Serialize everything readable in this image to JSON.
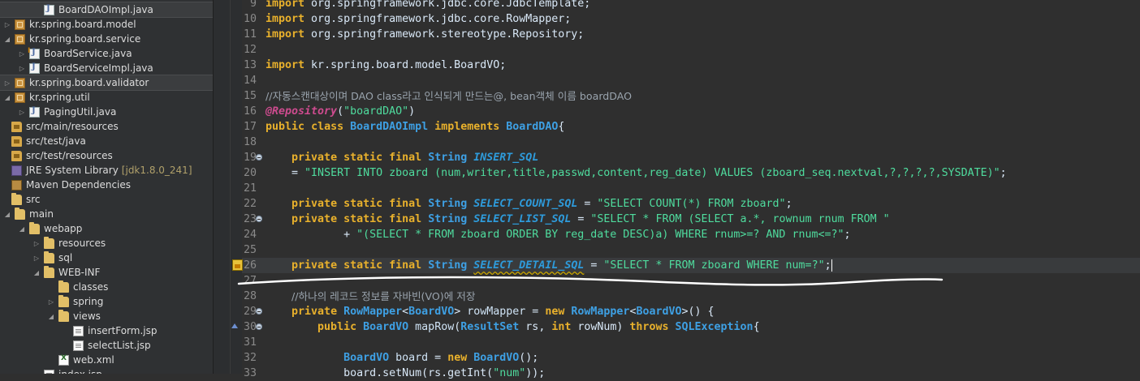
{
  "explorer": {
    "items": [
      {
        "label": "BoardDAOImpl.java",
        "icon": "java-class-icon",
        "twisty": "",
        "indent": 40
      },
      {
        "label": "kr.spring.board.model",
        "icon": "package-icon",
        "twisty": "▷",
        "indent": 4
      },
      {
        "label": "kr.spring.board.service",
        "icon": "package-icon",
        "twisty": "◢",
        "indent": 4
      },
      {
        "label": "BoardService.java",
        "icon": "java-interface-icon",
        "twisty": "▷",
        "indent": 22
      },
      {
        "label": "BoardServiceImpl.java",
        "icon": "java-class-icon",
        "twisty": "▷",
        "indent": 22
      },
      {
        "label": "kr.spring.board.validator",
        "icon": "package-icon",
        "twisty": "▷",
        "indent": 4
      },
      {
        "label": "kr.spring.util",
        "icon": "package-icon",
        "twisty": "◢",
        "indent": 4
      },
      {
        "label": "PagingUtil.java",
        "icon": "java-class-icon",
        "twisty": "▷",
        "indent": 22
      },
      {
        "label": "src/main/resources",
        "icon": "source-folder-icon",
        "twisty": "",
        "indent": 0
      },
      {
        "label": "src/test/java",
        "icon": "source-folder-icon",
        "twisty": "",
        "indent": 0
      },
      {
        "label": "src/test/resources",
        "icon": "source-folder-icon",
        "twisty": "",
        "indent": 0
      },
      {
        "label": "JRE System Library",
        "suffix": "[jdk1.8.0_241]",
        "icon": "library-icon",
        "twisty": "",
        "indent": 0
      },
      {
        "label": "Maven Dependencies",
        "icon": "jar-library-icon",
        "twisty": "",
        "indent": 0
      },
      {
        "label": "src",
        "icon": "folder-icon",
        "twisty": "",
        "indent": 0
      },
      {
        "label": "main",
        "icon": "folder-icon",
        "twisty": "◢",
        "indent": 4
      },
      {
        "label": "webapp",
        "icon": "folder-icon",
        "twisty": "◢",
        "indent": 22
      },
      {
        "label": "resources",
        "icon": "folder-icon",
        "twisty": "▷",
        "indent": 40
      },
      {
        "label": "sql",
        "icon": "folder-icon",
        "twisty": "▷",
        "indent": 40
      },
      {
        "label": "WEB-INF",
        "icon": "folder-icon",
        "twisty": "◢",
        "indent": 40
      },
      {
        "label": "classes",
        "icon": "folder-icon",
        "twisty": "",
        "indent": 58
      },
      {
        "label": "spring",
        "icon": "folder-icon",
        "twisty": "▷",
        "indent": 58
      },
      {
        "label": "views",
        "icon": "folder-icon",
        "twisty": "◢",
        "indent": 58
      },
      {
        "label": "insertForm.jsp",
        "icon": "file-icon",
        "twisty": "",
        "indent": 76
      },
      {
        "label": "selectList.jsp",
        "icon": "file-icon",
        "twisty": "",
        "indent": 76
      },
      {
        "label": "web.xml",
        "icon": "xml-file-icon",
        "twisty": "",
        "indent": 58
      },
      {
        "label": "index.jsp",
        "icon": "file-icon",
        "twisty": "",
        "indent": 40
      }
    ]
  },
  "editor": {
    "lines": [
      {
        "n": "9",
        "html": [
          [
            "kw",
            "import"
          ],
          [
            "plain",
            " org.springframework.jdbc.core.JdbcTemplate;"
          ]
        ]
      },
      {
        "n": "10",
        "html": [
          [
            "kw",
            "import"
          ],
          [
            "plain",
            " org.springframework.jdbc.core.RowMapper;"
          ]
        ]
      },
      {
        "n": "11",
        "html": [
          [
            "kw",
            "import"
          ],
          [
            "plain",
            " org.springframework.stereotype.Repository;"
          ]
        ]
      },
      {
        "n": "12",
        "html": []
      },
      {
        "n": "13",
        "html": [
          [
            "kw",
            "import"
          ],
          [
            "plain",
            " kr.spring.board.model.BoardVO;"
          ]
        ]
      },
      {
        "n": "14",
        "html": []
      },
      {
        "n": "15",
        "html": [
          [
            "cm",
            "//자동스캔대상이며 DAO class라고 인식되게 만드는@, bean객체 이름 boardDAO"
          ]
        ]
      },
      {
        "n": "16",
        "html": [
          [
            "ann",
            "@Repository"
          ],
          [
            "plain",
            "("
          ],
          [
            "st",
            "\"boardDAO\""
          ],
          [
            "plain",
            ")"
          ]
        ]
      },
      {
        "n": "17",
        "html": [
          [
            "kw",
            "public"
          ],
          [
            "plain",
            " "
          ],
          [
            "kw",
            "class"
          ],
          [
            "plain",
            " "
          ],
          [
            "ty",
            "BoardDAOImpl"
          ],
          [
            "plain",
            " "
          ],
          [
            "kw",
            "implements"
          ],
          [
            "plain",
            " "
          ],
          [
            "ty",
            "BoardDAO"
          ],
          [
            "plain",
            "{"
          ]
        ]
      },
      {
        "n": "18",
        "html": []
      },
      {
        "n": "19",
        "fold": true,
        "html": [
          [
            "plain",
            "    "
          ],
          [
            "kw",
            "private"
          ],
          [
            "plain",
            " "
          ],
          [
            "kw",
            "static"
          ],
          [
            "plain",
            " "
          ],
          [
            "kw",
            "final"
          ],
          [
            "plain",
            " "
          ],
          [
            "ty",
            "String"
          ],
          [
            "plain",
            " "
          ],
          [
            "cs",
            "INSERT_SQL"
          ]
        ]
      },
      {
        "n": "20",
        "html": [
          [
            "plain",
            "    = "
          ],
          [
            "st",
            "\"INSERT INTO zboard (num,writer,title,passwd,content,reg_date) VALUES (zboard_seq.nextval,?,?,?,?,SYSDATE)\""
          ],
          [
            "plain",
            ";"
          ]
        ]
      },
      {
        "n": "21",
        "html": []
      },
      {
        "n": "22",
        "html": [
          [
            "plain",
            "    "
          ],
          [
            "kw",
            "private"
          ],
          [
            "plain",
            " "
          ],
          [
            "kw",
            "static"
          ],
          [
            "plain",
            " "
          ],
          [
            "kw",
            "final"
          ],
          [
            "plain",
            " "
          ],
          [
            "ty",
            "String"
          ],
          [
            "plain",
            " "
          ],
          [
            "cs",
            "SELECT_COUNT_SQL"
          ],
          [
            "plain",
            " = "
          ],
          [
            "st",
            "\"SELECT COUNT(*) FROM zboard\""
          ],
          [
            "plain",
            ";"
          ]
        ]
      },
      {
        "n": "23",
        "fold": true,
        "html": [
          [
            "plain",
            "    "
          ],
          [
            "kw",
            "private"
          ],
          [
            "plain",
            " "
          ],
          [
            "kw",
            "static"
          ],
          [
            "plain",
            " "
          ],
          [
            "kw",
            "final"
          ],
          [
            "plain",
            " "
          ],
          [
            "ty",
            "String"
          ],
          [
            "plain",
            " "
          ],
          [
            "cs",
            "SELECT_LIST_SQL"
          ],
          [
            "plain",
            " = "
          ],
          [
            "st",
            "\"SELECT * FROM (SELECT a.*, rownum rnum FROM \""
          ]
        ]
      },
      {
        "n": "24",
        "html": [
          [
            "plain",
            "            + "
          ],
          [
            "st",
            "\"(SELECT * FROM zboard ORDER BY reg_date DESC)a) WHERE rnum>=? AND rnum<=?\""
          ],
          [
            "plain",
            ";"
          ]
        ]
      },
      {
        "n": "25",
        "html": []
      },
      {
        "n": "26",
        "current": true,
        "warning": true,
        "html": [
          [
            "plain",
            "    "
          ],
          [
            "kw",
            "private"
          ],
          [
            "plain",
            " "
          ],
          [
            "kw",
            "static"
          ],
          [
            "plain",
            " "
          ],
          [
            "kw",
            "final"
          ],
          [
            "plain",
            " "
          ],
          [
            "ty",
            "String"
          ],
          [
            "plain",
            " "
          ],
          [
            "cs squiggle",
            "SELECT_DETAIL_SQL"
          ],
          [
            "plain",
            " = "
          ],
          [
            "st",
            "\"SELECT * FROM zboard WHERE num=?\""
          ],
          [
            "plain",
            ";"
          ]
        ]
      },
      {
        "n": "27",
        "html": []
      },
      {
        "n": "28",
        "html": [
          [
            "plain",
            "    "
          ],
          [
            "cm",
            "//하나의 레코드 정보를 자바빈(VO)에 저장"
          ]
        ]
      },
      {
        "n": "29",
        "fold": true,
        "html": [
          [
            "plain",
            "    "
          ],
          [
            "kw",
            "private"
          ],
          [
            "plain",
            " "
          ],
          [
            "ty",
            "RowMapper"
          ],
          [
            "plain",
            "<"
          ],
          [
            "ty",
            "BoardVO"
          ],
          [
            "plain",
            "> "
          ],
          [
            "fn",
            "rowMapper"
          ],
          [
            "plain",
            " = "
          ],
          [
            "kw",
            "new"
          ],
          [
            "plain",
            " "
          ],
          [
            "ty",
            "RowMapper"
          ],
          [
            "plain",
            "<"
          ],
          [
            "ty",
            "BoardVO"
          ],
          [
            "plain",
            ">() {"
          ]
        ]
      },
      {
        "n": "30",
        "fold": true,
        "override": true,
        "html": [
          [
            "plain",
            "        "
          ],
          [
            "kw",
            "public"
          ],
          [
            "plain",
            " "
          ],
          [
            "ty",
            "BoardVO"
          ],
          [
            "plain",
            " "
          ],
          [
            "fn",
            "mapRow"
          ],
          [
            "plain",
            "("
          ],
          [
            "ty",
            "ResultSet"
          ],
          [
            "plain",
            " rs, "
          ],
          [
            "kw",
            "int"
          ],
          [
            "plain",
            " rowNum) "
          ],
          [
            "kw",
            "throws"
          ],
          [
            "plain",
            " "
          ],
          [
            "ty",
            "SQLException"
          ],
          [
            "plain",
            "{"
          ]
        ]
      },
      {
        "n": "31",
        "html": []
      },
      {
        "n": "32",
        "html": [
          [
            "plain",
            "            "
          ],
          [
            "ty",
            "BoardVO"
          ],
          [
            "plain",
            " "
          ],
          [
            "fn",
            "board"
          ],
          [
            "plain",
            " = "
          ],
          [
            "kw",
            "new"
          ],
          [
            "plain",
            " "
          ],
          [
            "ty",
            "BoardVO"
          ],
          [
            "plain",
            "();"
          ]
        ]
      },
      {
        "n": "33",
        "html": [
          [
            "plain",
            "            board.setNum(rs.getInt("
          ],
          [
            "st",
            "\"num\""
          ],
          [
            "plain",
            "));"
          ]
        ]
      }
    ]
  }
}
